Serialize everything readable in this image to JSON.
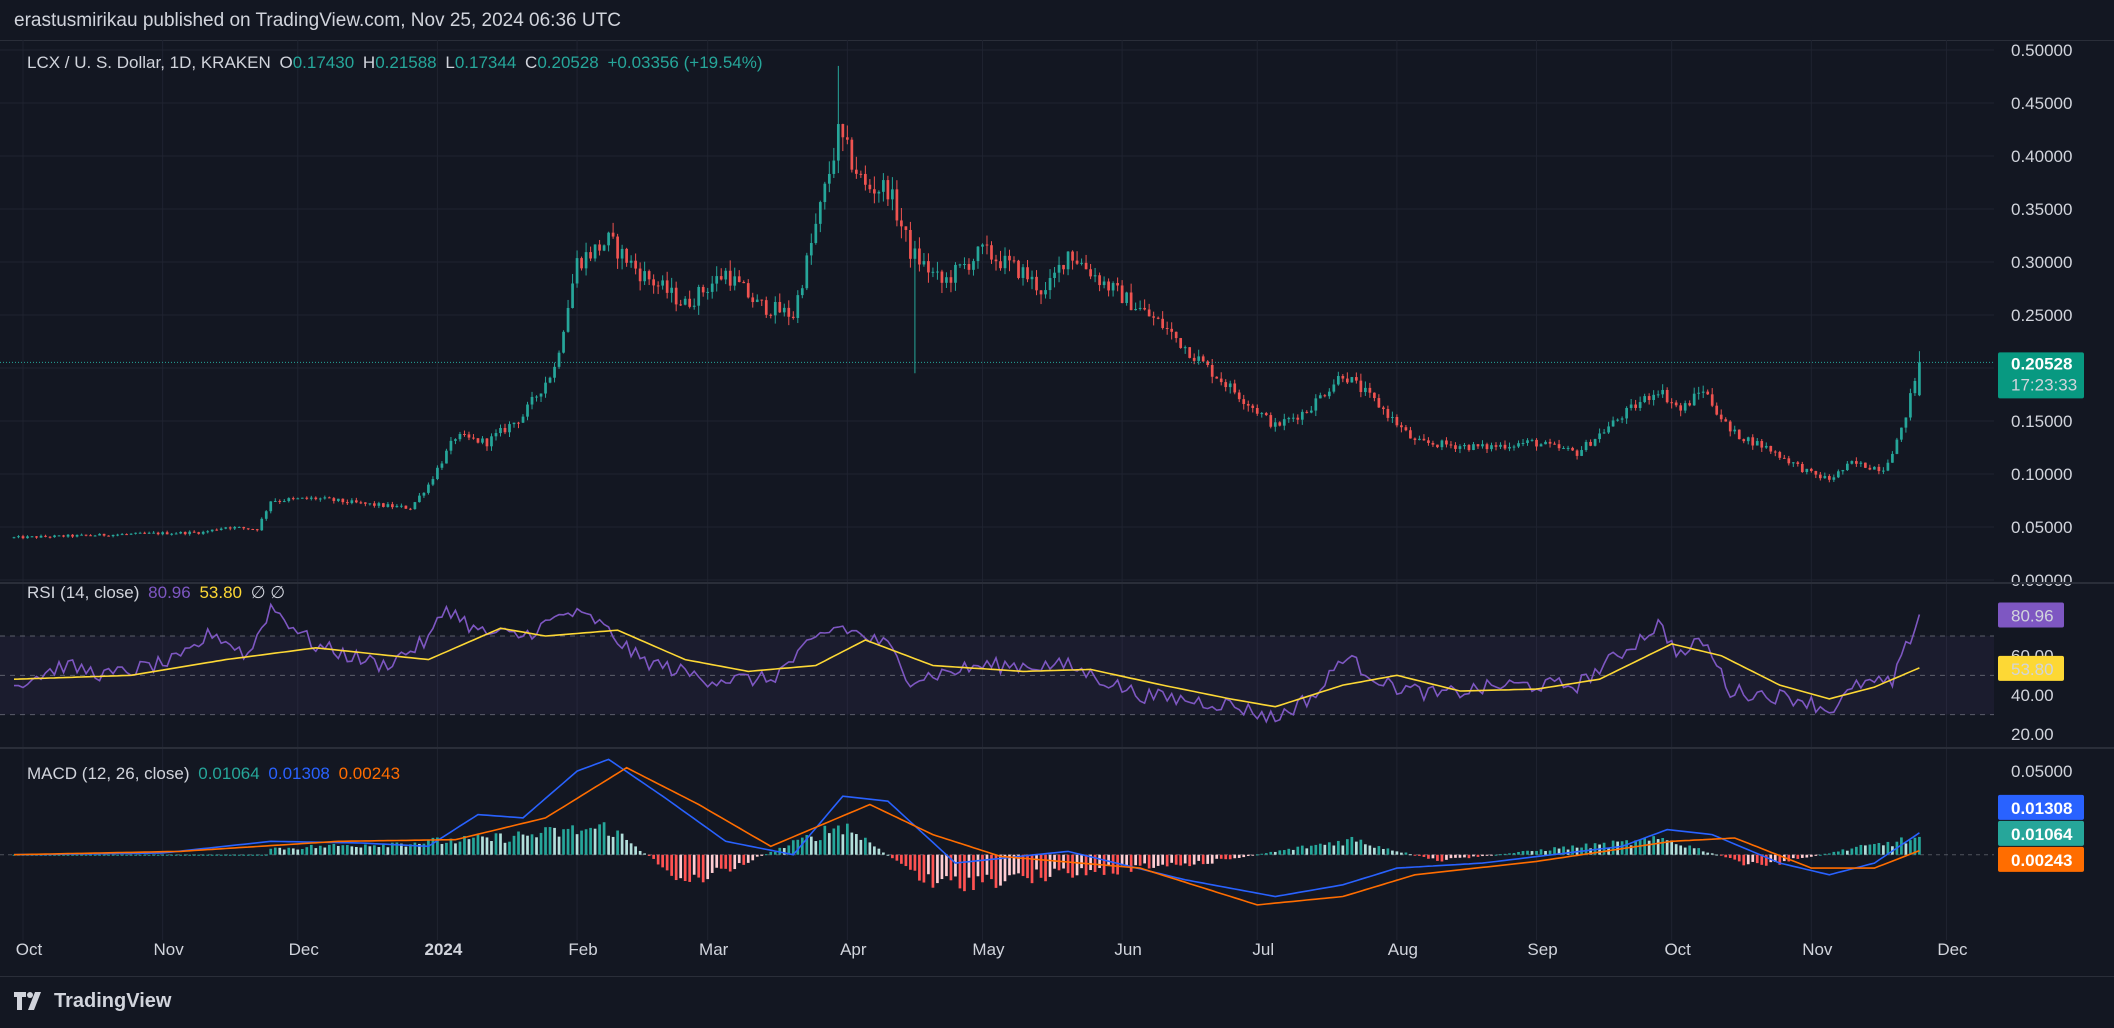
{
  "header": {
    "publish_line": "erastusmirikau published on TradingView.com, Nov 25, 2024 06:36 UTC"
  },
  "footer": {
    "brand": "TradingView"
  },
  "colors": {
    "background": "#131722",
    "grid": "#1f2330",
    "up": "#26a69a",
    "down": "#ef5350",
    "rsi_line": "#7e57c2",
    "rsi_ma": "#fdd835",
    "macd_line": "#2962ff",
    "signal_line": "#ff6d00",
    "hist_up_strong": "#26a69a",
    "hist_up_weak": "#b2dfdb",
    "hist_down_strong": "#ff5252",
    "hist_down_weak": "#ffcdd2"
  },
  "legend": {
    "symbol": "LCX / U. S. Dollar, 1D, KRAKEN",
    "o_label": "O",
    "o_value": "0.17430",
    "h_label": "H",
    "h_value": "0.21588",
    "l_label": "L",
    "l_value": "0.17344",
    "c_label": "C",
    "c_value": "0.20528",
    "change": "+0.03356 (+19.54%)",
    "rsi_label": "RSI (14, close)",
    "rsi_value": "80.96",
    "rsi_ma_value": "53.80",
    "rsi_extra": "∅ ∅",
    "macd_label": "MACD (12, 26, close)",
    "macd_hist_value": "0.01064",
    "macd_value": "0.01308",
    "signal_value": "0.00243"
  },
  "price_badge": {
    "price": "0.20528",
    "countdown": "17:23:33"
  },
  "chart_data": [
    {
      "type": "candlestick",
      "title": "LCX / U. S. Dollar, 1D, KRAKEN",
      "x_ticks": [
        "Oct",
        "Nov",
        "Dec",
        "2024",
        "Feb",
        "Mar",
        "Apr",
        "May",
        "Jun",
        "Jul",
        "Aug",
        "Sep",
        "Oct",
        "Nov",
        "Dec"
      ],
      "x_range": [
        "2023-09-29",
        "2024-12-12"
      ],
      "y_ticks": [
        "0.00000",
        "0.05000",
        "0.10000",
        "0.15000",
        "0.20000",
        "0.25000",
        "0.30000",
        "0.35000",
        "0.40000",
        "0.45000",
        "0.50000"
      ],
      "ylim": [
        0,
        0.5
      ],
      "last_close": 0.20528,
      "series": [
        {
          "name": "close",
          "points": [
            [
              "2023-09-29",
              0.04
            ],
            [
              "2023-10-15",
              0.042
            ],
            [
              "2023-10-31",
              0.044
            ],
            [
              "2023-11-10",
              0.045
            ],
            [
              "2023-11-15",
              0.05
            ],
            [
              "2023-11-22",
              0.048
            ],
            [
              "2023-11-25",
              0.075
            ],
            [
              "2023-12-05",
              0.077
            ],
            [
              "2023-12-15",
              0.072
            ],
            [
              "2023-12-26",
              0.068
            ],
            [
              "2023-12-30",
              0.09
            ],
            [
              "2024-01-05",
              0.135
            ],
            [
              "2024-01-12",
              0.13
            ],
            [
              "2024-01-20",
              0.155
            ],
            [
              "2024-01-27",
              0.2
            ],
            [
              "2024-02-01",
              0.3
            ],
            [
              "2024-02-08",
              0.32
            ],
            [
              "2024-02-15",
              0.29
            ],
            [
              "2024-02-25",
              0.26
            ],
            [
              "2024-03-05",
              0.29
            ],
            [
              "2024-03-12",
              0.26
            ],
            [
              "2024-03-20",
              0.25
            ],
            [
              "2024-03-26",
              0.35
            ],
            [
              "2024-03-30",
              0.42
            ],
            [
              "2024-04-05",
              0.37
            ],
            [
              "2024-04-10",
              0.37
            ],
            [
              "2024-04-15",
              0.31
            ],
            [
              "2024-04-22",
              0.28
            ],
            [
              "2024-05-01",
              0.31
            ],
            [
              "2024-05-10",
              0.29
            ],
            [
              "2024-05-15",
              0.27
            ],
            [
              "2024-05-20",
              0.31
            ],
            [
              "2024-05-28",
              0.28
            ],
            [
              "2024-06-10",
              0.24
            ],
            [
              "2024-06-20",
              0.2
            ],
            [
              "2024-07-05",
              0.145
            ],
            [
              "2024-07-12",
              0.16
            ],
            [
              "2024-07-20",
              0.195
            ],
            [
              "2024-07-28",
              0.165
            ],
            [
              "2024-08-05",
              0.13
            ],
            [
              "2024-08-20",
              0.125
            ],
            [
              "2024-08-31",
              0.13
            ],
            [
              "2024-09-10",
              0.12
            ],
            [
              "2024-09-20",
              0.155
            ],
            [
              "2024-09-28",
              0.18
            ],
            [
              "2024-10-03",
              0.16
            ],
            [
              "2024-10-08",
              0.18
            ],
            [
              "2024-10-14",
              0.14
            ],
            [
              "2024-10-22",
              0.125
            ],
            [
              "2024-11-01",
              0.1
            ],
            [
              "2024-11-05",
              0.095
            ],
            [
              "2024-11-10",
              0.11
            ],
            [
              "2024-11-17",
              0.105
            ],
            [
              "2024-11-21",
              0.14
            ],
            [
              "2024-11-25",
              0.205
            ]
          ]
        }
      ]
    },
    {
      "type": "line",
      "title": "RSI (14, close)",
      "y_ticks": [
        "20.00",
        "40.00",
        "60.00"
      ],
      "ylim": [
        14,
        96
      ],
      "bands": [
        30,
        50,
        70
      ],
      "x_range": [
        "2023-09-29",
        "2024-12-12"
      ],
      "series": [
        {
          "name": "RSI",
          "last": 80.96,
          "points": [
            [
              "2023-09-29",
              45
            ],
            [
              "2023-10-10",
              55
            ],
            [
              "2023-10-20",
              50
            ],
            [
              "2023-11-05",
              58
            ],
            [
              "2023-11-12",
              72
            ],
            [
              "2023-11-20",
              60
            ],
            [
              "2023-11-25",
              85
            ],
            [
              "2023-12-05",
              65
            ],
            [
              "2023-12-20",
              55
            ],
            [
              "2023-12-30",
              68
            ],
            [
              "2024-01-03",
              85
            ],
            [
              "2024-01-10",
              72
            ],
            [
              "2024-01-20",
              70
            ],
            [
              "2024-01-30",
              82
            ],
            [
              "2024-02-05",
              78
            ],
            [
              "2024-02-15",
              58
            ],
            [
              "2024-03-01",
              48
            ],
            [
              "2024-03-15",
              48
            ],
            [
              "2024-03-26",
              70
            ],
            [
              "2024-03-30",
              75
            ],
            [
              "2024-04-10",
              65
            ],
            [
              "2024-04-15",
              48
            ],
            [
              "2024-05-01",
              55
            ],
            [
              "2024-05-20",
              55
            ],
            [
              "2024-06-05",
              40
            ],
            [
              "2024-06-25",
              35
            ],
            [
              "2024-07-05",
              28
            ],
            [
              "2024-07-15",
              42
            ],
            [
              "2024-07-20",
              60
            ],
            [
              "2024-07-30",
              45
            ],
            [
              "2024-08-10",
              40
            ],
            [
              "2024-08-25",
              45
            ],
            [
              "2024-09-10",
              45
            ],
            [
              "2024-09-22",
              65
            ],
            [
              "2024-09-28",
              76
            ],
            [
              "2024-10-03",
              60
            ],
            [
              "2024-10-08",
              68
            ],
            [
              "2024-10-14",
              42
            ],
            [
              "2024-10-30",
              38
            ],
            [
              "2024-11-05",
              32
            ],
            [
              "2024-11-12",
              46
            ],
            [
              "2024-11-19",
              46
            ],
            [
              "2024-11-25",
              80.96
            ]
          ]
        },
        {
          "name": "RSI-based MA",
          "last": 53.8,
          "points": [
            [
              "2023-09-29",
              48
            ],
            [
              "2023-10-25",
              50
            ],
            [
              "2023-11-15",
              58
            ],
            [
              "2023-12-05",
              64
            ],
            [
              "2023-12-30",
              58
            ],
            [
              "2024-01-15",
              74
            ],
            [
              "2024-01-25",
              70
            ],
            [
              "2024-02-10",
              73
            ],
            [
              "2024-02-25",
              58
            ],
            [
              "2024-03-10",
              52
            ],
            [
              "2024-03-25",
              55
            ],
            [
              "2024-04-05",
              68
            ],
            [
              "2024-04-20",
              55
            ],
            [
              "2024-05-10",
              52
            ],
            [
              "2024-05-25",
              53
            ],
            [
              "2024-06-10",
              45
            ],
            [
              "2024-06-25",
              38
            ],
            [
              "2024-07-05",
              34
            ],
            [
              "2024-07-20",
              45
            ],
            [
              "2024-08-01",
              50
            ],
            [
              "2024-08-15",
              42
            ],
            [
              "2024-09-01",
              43
            ],
            [
              "2024-09-15",
              48
            ],
            [
              "2024-10-01",
              66
            ],
            [
              "2024-10-12",
              60
            ],
            [
              "2024-10-25",
              45
            ],
            [
              "2024-11-05",
              38
            ],
            [
              "2024-11-15",
              44
            ],
            [
              "2024-11-25",
              53.8
            ]
          ]
        }
      ]
    },
    {
      "type": "bar",
      "title": "MACD (12, 26, close)",
      "y_ticks": [
        "0.05000"
      ],
      "ylim": [
        -0.048,
        0.062
      ],
      "x_range": [
        "2023-09-29",
        "2024-12-12"
      ],
      "series": [
        {
          "name": "MACD",
          "last": 0.01308,
          "points": [
            [
              "2023-09-29",
              0.0
            ],
            [
              "2023-11-01",
              0.001
            ],
            [
              "2023-11-25",
              0.008
            ],
            [
              "2023-12-15",
              0.007
            ],
            [
              "2023-12-30",
              0.005
            ],
            [
              "2024-01-10",
              0.024
            ],
            [
              "2024-01-20",
              0.022
            ],
            [
              "2024-02-01",
              0.05
            ],
            [
              "2024-02-08",
              0.057
            ],
            [
              "2024-02-20",
              0.035
            ],
            [
              "2024-03-05",
              0.008
            ],
            [
              "2024-03-20",
              0.0
            ],
            [
              "2024-03-31",
              0.035
            ],
            [
              "2024-04-10",
              0.032
            ],
            [
              "2024-04-25",
              -0.005
            ],
            [
              "2024-05-20",
              0.002
            ],
            [
              "2024-06-15",
              -0.015
            ],
            [
              "2024-07-05",
              -0.025
            ],
            [
              "2024-07-20",
              -0.018
            ],
            [
              "2024-08-01",
              -0.008
            ],
            [
              "2024-08-20",
              -0.005
            ],
            [
              "2024-09-20",
              0.005
            ],
            [
              "2024-09-30",
              0.015
            ],
            [
              "2024-10-10",
              0.012
            ],
            [
              "2024-10-25",
              -0.005
            ],
            [
              "2024-11-05",
              -0.012
            ],
            [
              "2024-11-15",
              -0.005
            ],
            [
              "2024-11-25",
              0.01308
            ]
          ]
        },
        {
          "name": "Signal",
          "last": 0.00243,
          "points": [
            [
              "2023-09-29",
              0.0
            ],
            [
              "2023-11-05",
              0.002
            ],
            [
              "2023-12-10",
              0.008
            ],
            [
              "2024-01-05",
              0.009
            ],
            [
              "2024-01-25",
              0.022
            ],
            [
              "2024-02-12",
              0.052
            ],
            [
              "2024-02-28",
              0.03
            ],
            [
              "2024-03-15",
              0.005
            ],
            [
              "2024-04-06",
              0.03
            ],
            [
              "2024-04-20",
              0.012
            ],
            [
              "2024-05-05",
              -0.001
            ],
            [
              "2024-06-05",
              -0.008
            ],
            [
              "2024-07-01",
              -0.03
            ],
            [
              "2024-07-20",
              -0.025
            ],
            [
              "2024-08-05",
              -0.012
            ],
            [
              "2024-09-01",
              -0.004
            ],
            [
              "2024-10-01",
              0.008
            ],
            [
              "2024-10-15",
              0.01
            ],
            [
              "2024-11-01",
              -0.008
            ],
            [
              "2024-11-15",
              -0.008
            ],
            [
              "2024-11-25",
              0.00243
            ]
          ]
        },
        {
          "name": "Histogram",
          "last": 0.01064,
          "points": [
            [
              "2023-11-25",
              0.004
            ],
            [
              "2024-01-10",
              0.01
            ],
            [
              "2024-02-08",
              0.018
            ],
            [
              "2024-02-25",
              -0.018
            ],
            [
              "2024-03-05",
              -0.01
            ],
            [
              "2024-03-31",
              0.02
            ],
            [
              "2024-04-20",
              -0.02
            ],
            [
              "2024-06-20",
              -0.005
            ],
            [
              "2024-07-22",
              0.01
            ],
            [
              "2024-08-10",
              -0.004
            ],
            [
              "2024-09-05",
              0.004
            ],
            [
              "2024-09-30",
              0.01
            ],
            [
              "2024-10-20",
              -0.008
            ],
            [
              "2024-11-10",
              0.004
            ],
            [
              "2024-11-25",
              0.01064
            ]
          ]
        }
      ]
    }
  ]
}
